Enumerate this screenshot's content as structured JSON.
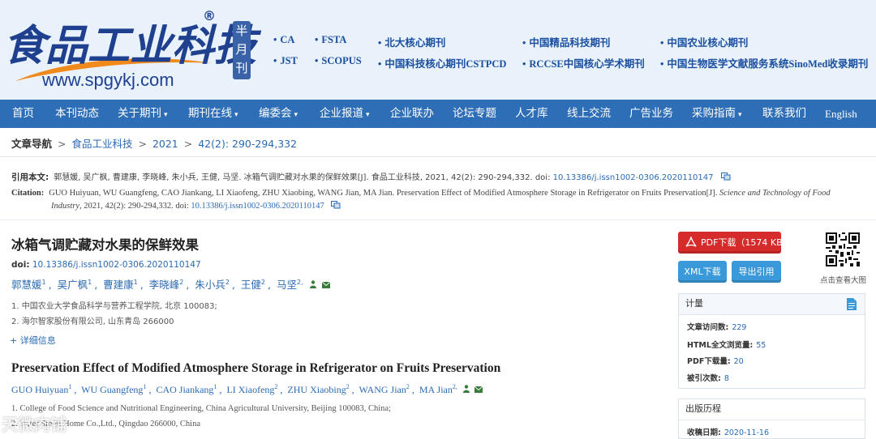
{
  "header": {
    "logo_text": "食品工业科技",
    "logo_reg": "®",
    "logo_url": "www.spgykj.com",
    "half_month": "半月刊",
    "indexes": [
      "CA",
      "FSTA",
      "北大核心期刊",
      "中国精品科技期刊",
      "中国农业核心期刊",
      "JST",
      "SCOPUS",
      "中国科技核心期刊CSTPCD",
      "RCCSE中国核心学术期刊",
      "中国生物医学文献服务系统SinoMed收录期刊"
    ]
  },
  "nav": {
    "items": [
      {
        "label": "首页",
        "dropdown": false
      },
      {
        "label": "本刊动态",
        "dropdown": false
      },
      {
        "label": "关于期刊",
        "dropdown": true
      },
      {
        "label": "期刊在线",
        "dropdown": true
      },
      {
        "label": "编委会",
        "dropdown": true
      },
      {
        "label": "企业报道",
        "dropdown": true
      },
      {
        "label": "企业联办",
        "dropdown": false
      },
      {
        "label": "论坛专题",
        "dropdown": false
      },
      {
        "label": "人才库",
        "dropdown": false
      },
      {
        "label": "线上交流",
        "dropdown": false
      },
      {
        "label": "广告业务",
        "dropdown": false
      },
      {
        "label": "采购指南",
        "dropdown": true
      },
      {
        "label": "联系我们",
        "dropdown": false
      },
      {
        "label": "English",
        "dropdown": false
      }
    ],
    "caret": "▾"
  },
  "breadcrumb": {
    "label": "文章导航",
    "sep": ">",
    "journal": "食品工业科技",
    "year": "2021",
    "issue": "42(2): 290-294,332"
  },
  "citation": {
    "cn_label": "引用本文:",
    "cn_text": "郭慧媛, 吴广枫, 曹建康, 李晓峰, 朱小兵, 王健, 马坚. 冰箱气调贮藏对水果的保鲜效果[J]. 食品工业科技, 2021, 42(2): 290-294,332. doi: ",
    "cn_doi": "10.13386/j.issn1002-0306.2020110147",
    "en_label": "Citation:",
    "en_text": "GUO Huiyuan, WU Guangfeng, CAO Jiankang, LI Xiaofeng, ZHU Xiaobing, WANG Jian, MA Jian. Preservation Effect of Modified Atmosphere Storage in Refrigerator on Fruits Preservation[J].",
    "en_journal_a": "Science and Technology of Food",
    "en_journal_b": "Industry",
    "en_text2": ", 2021, 42(2): 290-294,332. doi: ",
    "en_doi": "10.13386/j.issn1002-0306.2020110147"
  },
  "article": {
    "title_cn": "冰箱气调贮藏对水果的保鲜效果",
    "doi_label": "doi:",
    "doi": "10.13386/j.issn1002-0306.2020110147",
    "authors_cn": [
      {
        "name": "郭慧媛",
        "sup": "1"
      },
      {
        "name": "吴广枫",
        "sup": "1"
      },
      {
        "name": "曹建康",
        "sup": "1"
      },
      {
        "name": "李晓峰",
        "sup": "2"
      },
      {
        "name": "朱小兵",
        "sup": "2"
      },
      {
        "name": "王健",
        "sup": "2"
      },
      {
        "name": "马坚",
        "sup": "2,"
      }
    ],
    "aff_cn": [
      "1. 中国农业大学食品科学与营养工程学院, 北京 100083;",
      "2. 海尔智家股份有限公司, 山东青岛 266000"
    ],
    "more_info": "+ 详细信息",
    "title_en": "Preservation Effect of Modified Atmosphere Storage in Refrigerator on Fruits Preservation",
    "authors_en": [
      {
        "name": "GUO Huiyuan",
        "sup": "1"
      },
      {
        "name": "WU Guangfeng",
        "sup": "1"
      },
      {
        "name": "CAO Jiankang",
        "sup": "1"
      },
      {
        "name": "LI Xiaofeng",
        "sup": "2"
      },
      {
        "name": "ZHU Xiaobing",
        "sup": "2"
      },
      {
        "name": "WANG Jian",
        "sup": "2"
      },
      {
        "name": "MA Jian",
        "sup": "2,"
      }
    ],
    "aff_en": [
      "1. College of Food Science and Nutritional Engineering, China Agricultural University, Beijing 100083, China;",
      "2. Haier Smart Home Co.,Ltd., Qingdao 266000, China"
    ]
  },
  "sidebar": {
    "pdf_label": "PDF下载（1574 KB）",
    "xml_label": "XML下载",
    "export_label": "导出引用",
    "qr_caption": "点击查看大图",
    "stats_title": "计量",
    "stats": [
      {
        "label": "文章访问数:",
        "value": "229"
      },
      {
        "label": "HTML全文浏览量:",
        "value": "55"
      },
      {
        "label": "PDF下载量:",
        "value": "20"
      },
      {
        "label": "被引次数:",
        "value": "8"
      }
    ],
    "history_title": "出版历程",
    "received_label": "收稿日期:",
    "received_value": "2020-11-16"
  },
  "watermark": "天微肉铺",
  "colors": {
    "nav": "#2e6eb6",
    "link": "#2a6ab3",
    "pdf": "#d62b2b",
    "btn": "#3a9ad9",
    "header_bg": "#e9f1fb"
  }
}
